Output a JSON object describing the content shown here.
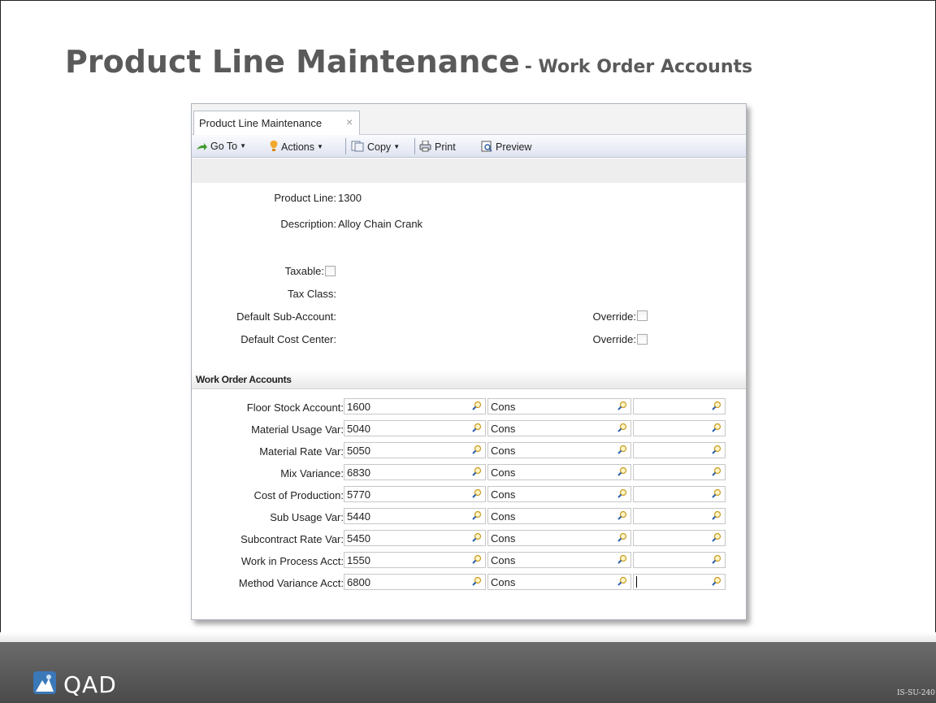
{
  "slide": {
    "title_main": "Product Line Maintenance",
    "title_sub": "- Work Order Accounts",
    "code": "IS-SU-240"
  },
  "window": {
    "tab_label": "Product Line Maintenance",
    "tab_close": "×"
  },
  "toolbar": {
    "goto": "Go To",
    "actions": "Actions",
    "copy": "Copy",
    "print": "Print",
    "preview": "Preview"
  },
  "header": {
    "product_line_label": "Product Line:",
    "product_line_value": "1300",
    "description_label": "Description:",
    "description_value": "Alloy Chain Crank",
    "taxable_label": "Taxable:",
    "tax_class_label": "Tax Class:",
    "default_sub_account_label": "Default Sub-Account:",
    "default_cost_center_label": "Default Cost Center:",
    "override_label": "Override:"
  },
  "section": {
    "title": "Work Order Accounts"
  },
  "accounts": [
    {
      "label": "Floor Stock Account:",
      "account": "1600",
      "sub": "Cons",
      "cc": ""
    },
    {
      "label": "Material Usage Var:",
      "account": "5040",
      "sub": "Cons",
      "cc": ""
    },
    {
      "label": "Material Rate Var:",
      "account": "5050",
      "sub": "Cons",
      "cc": ""
    },
    {
      "label": "Mix Variance:",
      "account": "6830",
      "sub": "Cons",
      "cc": ""
    },
    {
      "label": "Cost of Production:",
      "account": "5770",
      "sub": "Cons",
      "cc": ""
    },
    {
      "label": "Sub Usage Var:",
      "account": "5440",
      "sub": "Cons",
      "cc": ""
    },
    {
      "label": "Subcontract Rate Var:",
      "account": "5450",
      "sub": "Cons",
      "cc": ""
    },
    {
      "label": "Work in Process Acct:",
      "account": "1550",
      "sub": "Cons",
      "cc": ""
    },
    {
      "label": "Method Variance Acct:",
      "account": "6800",
      "sub": "Cons",
      "cc": ""
    }
  ],
  "footer": {
    "logo_text": "QAD"
  },
  "colors": {
    "title_grey": "#5a5a5a",
    "toolbar_gradient_end": "#dfe4f1",
    "footer_grey": "#555555",
    "logo_blue": "#3a78b8"
  },
  "icons": [
    "goto-arrow-icon",
    "actions-bulb-icon",
    "copy-icon",
    "print-icon",
    "preview-icon",
    "lookup-magnifier-icon",
    "qad-logo-icon",
    "close-tab-icon"
  ]
}
